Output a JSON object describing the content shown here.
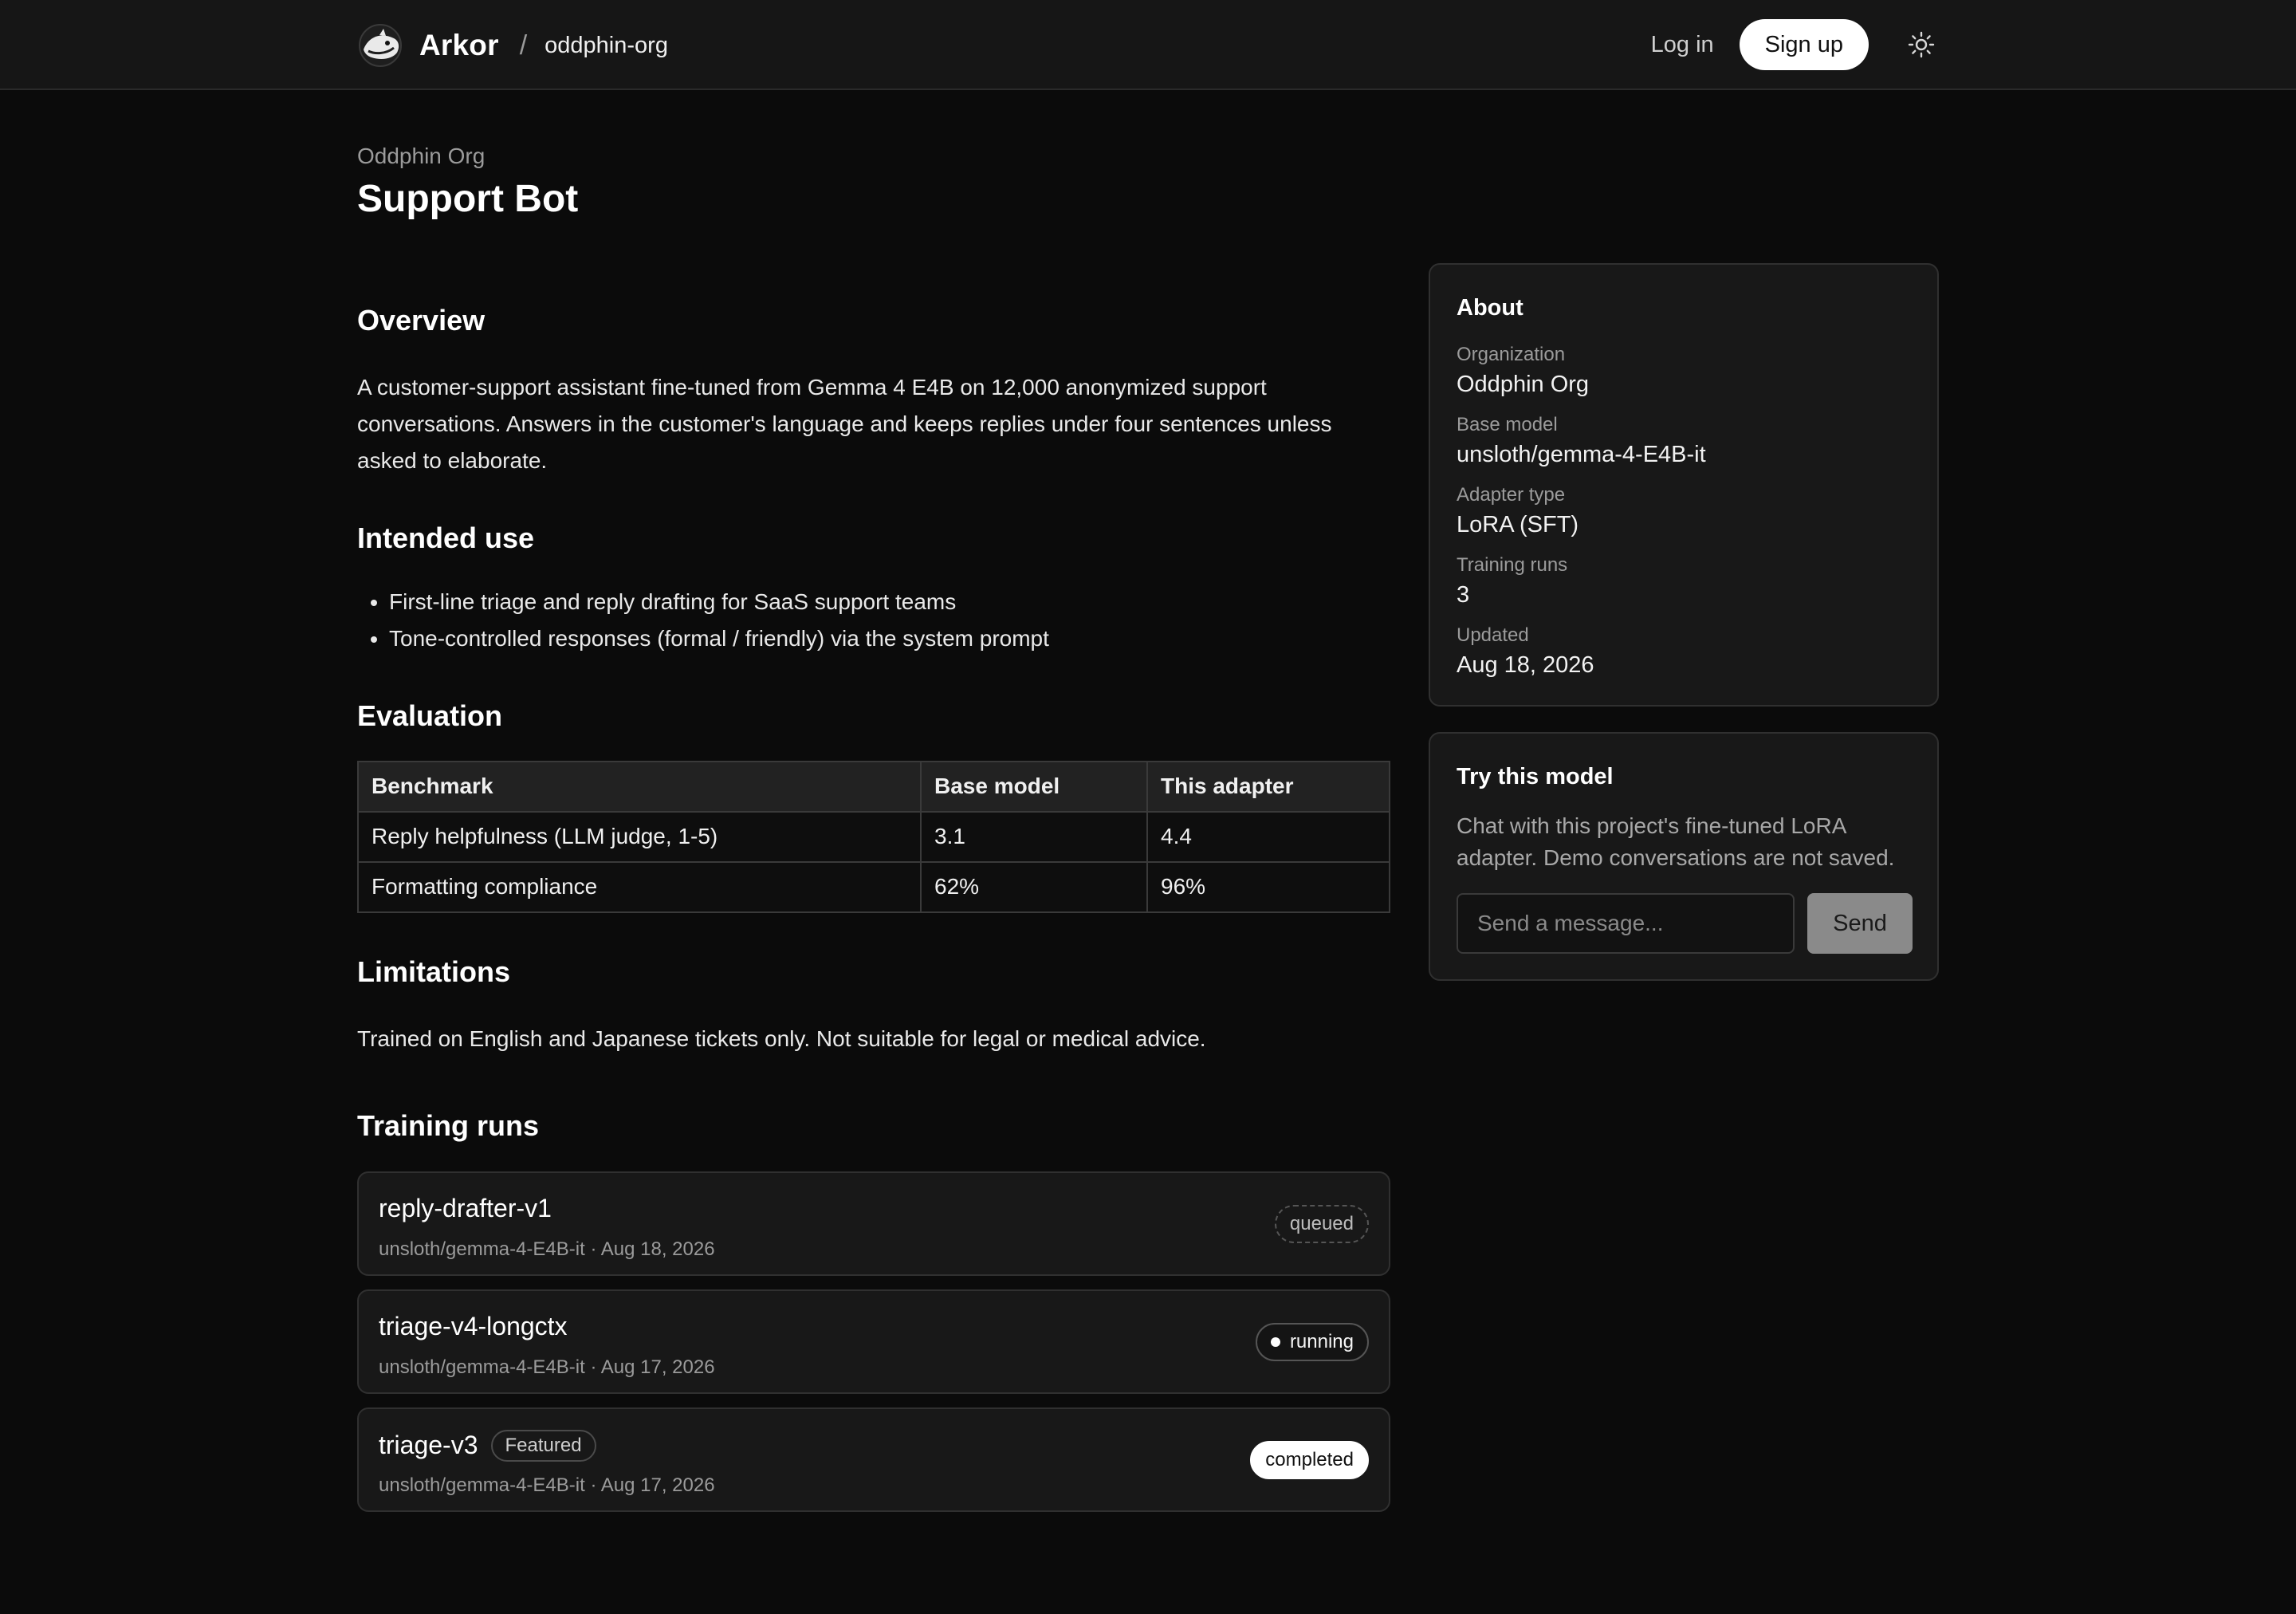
{
  "header": {
    "brand": "Arkor",
    "separator": "/",
    "org_slug": "oddphin-org",
    "login_label": "Log in",
    "signup_label": "Sign up",
    "logo_icon": "arkor-logo-icon",
    "theme_icon": "sun-icon"
  },
  "page": {
    "org_name": "Oddphin Org",
    "title": "Support Bot"
  },
  "overview": {
    "heading": "Overview",
    "text": "A customer-support assistant fine-tuned from Gemma 4 E4B on 12,000 anonymized support conversations. Answers in the customer's language and keeps replies under four sentences unless asked to elaborate."
  },
  "intended_use": {
    "heading": "Intended use",
    "items": [
      "First-line triage and reply drafting for SaaS support teams",
      "Tone-controlled responses (formal / friendly) via the system prompt"
    ]
  },
  "evaluation": {
    "heading": "Evaluation",
    "columns": [
      "Benchmark",
      "Base model",
      "This adapter"
    ],
    "rows": [
      [
        "Reply helpfulness (LLM judge, 1-5)",
        "3.1",
        "4.4"
      ],
      [
        "Formatting compliance",
        "62%",
        "96%"
      ]
    ]
  },
  "limitations": {
    "heading": "Limitations",
    "text": "Trained on English and Japanese tickets only. Not suitable for legal or medical advice."
  },
  "training_runs": {
    "heading": "Training runs",
    "runs": [
      {
        "name": "reply-drafter-v1",
        "meta": "unsloth/gemma-4-E4B-it · Aug 18, 2026",
        "status": "queued",
        "badge": ""
      },
      {
        "name": "triage-v4-longctx",
        "meta": "unsloth/gemma-4-E4B-it · Aug 17, 2026",
        "status": "running",
        "badge": ""
      },
      {
        "name": "triage-v3",
        "meta": "unsloth/gemma-4-E4B-it · Aug 17, 2026",
        "status": "completed",
        "badge": "Featured"
      }
    ]
  },
  "about": {
    "title": "About",
    "items": [
      {
        "label": "Organization",
        "value": "Oddphin Org"
      },
      {
        "label": "Base model",
        "value": "unsloth/gemma-4-E4B-it"
      },
      {
        "label": "Adapter type",
        "value": "LoRA (SFT)"
      },
      {
        "label": "Training runs",
        "value": "3"
      },
      {
        "label": "Updated",
        "value": "Aug 18, 2026"
      }
    ]
  },
  "try_model": {
    "title": "Try this model",
    "description": "Chat with this project's fine-tuned LoRA adapter. Demo conversations are not saved.",
    "input_placeholder": "Send a message...",
    "send_label": "Send"
  },
  "colors": {
    "background": "#0b0b0b",
    "header_bg": "#161616",
    "card_bg": "#181818",
    "border": "#303030",
    "accent": "#ffffff",
    "muted_text": "#9b9b9b"
  }
}
